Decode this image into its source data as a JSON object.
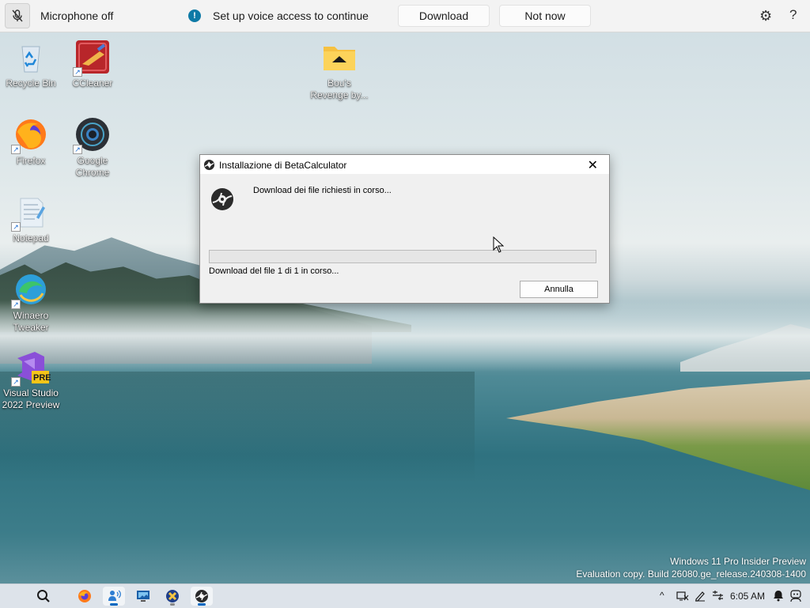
{
  "voice_bar": {
    "mic_status": "Microphone off",
    "message": "Set up voice access to continue",
    "download_label": "Download",
    "not_now_label": "Not now",
    "icons": [
      "mic-off-icon",
      "info-icon",
      "gear-icon",
      "help-icon"
    ]
  },
  "desktop_icons": [
    {
      "label": "Recycle Bin",
      "icon": "recycle-bin-icon"
    },
    {
      "label": "CCleaner",
      "icon": "ccleaner-icon"
    },
    {
      "label": "Bou's Revenge by...",
      "icon": "folder-icon"
    },
    {
      "label": "Firefox",
      "icon": "firefox-icon"
    },
    {
      "label": "Google Chrome",
      "icon": "chrome-icon"
    },
    {
      "label": "Notepad",
      "icon": "notepad-icon"
    },
    {
      "label": "Winaero Tweaker",
      "icon": "winaero-tweaker-icon"
    },
    {
      "label": "Visual Studio 2022 Preview",
      "icon": "visual-studio-icon",
      "badge": "PRE"
    }
  ],
  "dialog": {
    "title": "Installazione di BetaCalculator",
    "message": "Download dei file richiesti in corso...",
    "status": "Download del file 1 di 1 in corso...",
    "progress": 0,
    "cancel_label": "Annulla"
  },
  "watermark": {
    "line1": "Windows 11 Pro Insider Preview",
    "line2": "Evaluation copy. Build 26080.ge_release.240308-1400"
  },
  "taskbar": {
    "items": [
      "search-icon",
      "firefox-icon",
      "voice-access-icon",
      "remote-desktop-icon",
      "winaero-icon",
      "betacalculator-icon"
    ],
    "clock": "6:05 AM"
  },
  "colors": {
    "accent": "#0067c0",
    "voice_info": "#0e7aa6"
  }
}
